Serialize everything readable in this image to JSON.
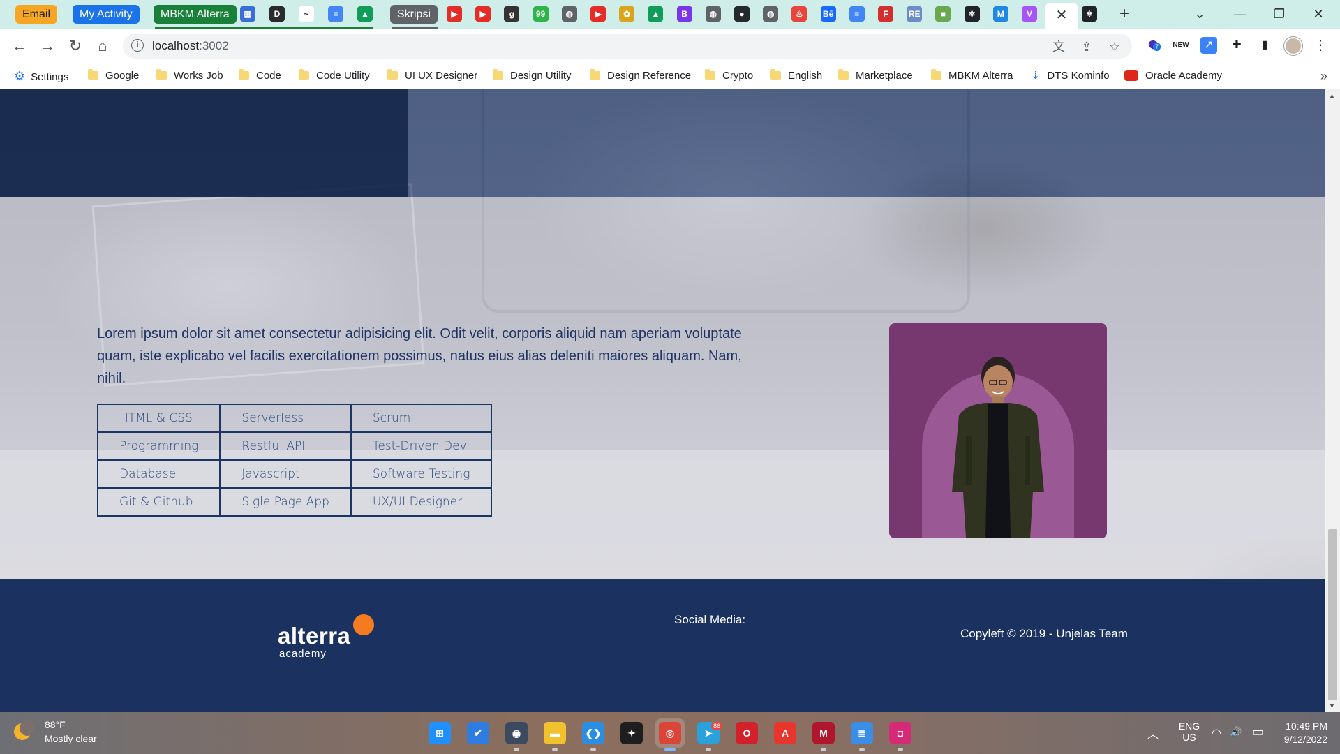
{
  "tabs": {
    "pills": [
      {
        "label": "Email",
        "color": "#f6a623",
        "text_color": "#222"
      },
      {
        "label": "My Activity",
        "color": "#1a73e8",
        "text_color": "#fff"
      },
      {
        "label": "MBKM Alterra",
        "color": "#188038",
        "text_color": "#fff"
      },
      {
        "label": "Skripsi",
        "color": "#5f6368",
        "text_color": "#fff"
      }
    ],
    "favicons": [
      {
        "icon": "calendar-icon",
        "glyph": "▦",
        "color": "#3a6fd8"
      },
      {
        "icon": "d-icon",
        "glyph": "D",
        "color": "#2b2b2b"
      },
      {
        "icon": "chart-icon",
        "glyph": "~",
        "color": "#ffffff"
      },
      {
        "icon": "docs-icon",
        "glyph": "≡",
        "color": "#4285f4"
      },
      {
        "icon": "drive-icon",
        "glyph": "▲",
        "color": "#0f9d58"
      },
      {
        "icon": "youtube-icon",
        "glyph": "▶",
        "color": "#e52d27"
      },
      {
        "icon": "youtube-icon",
        "glyph": "▶",
        "color": "#e52d27"
      },
      {
        "icon": "g-icon",
        "glyph": "g",
        "color": "#333333"
      },
      {
        "icon": "badge-icon",
        "glyph": "99",
        "color": "#2fb44a"
      },
      {
        "icon": "globe-icon",
        "glyph": "◍",
        "color": "#5f6368"
      },
      {
        "icon": "youtube-icon",
        "glyph": "▶",
        "color": "#e52d27"
      },
      {
        "icon": "crest-icon",
        "glyph": "✿",
        "color": "#d8a51d"
      },
      {
        "icon": "drive-icon",
        "glyph": "▲",
        "color": "#0f9d58"
      },
      {
        "icon": "bootstrap-icon",
        "glyph": "B",
        "color": "#7b35e8"
      },
      {
        "icon": "globe-icon",
        "glyph": "◍",
        "color": "#5f6368"
      },
      {
        "icon": "github-icon",
        "glyph": "●",
        "color": "#24292e"
      },
      {
        "icon": "globe-icon",
        "glyph": "◍",
        "color": "#5f6368"
      },
      {
        "icon": "fire-icon",
        "glyph": "♨",
        "color": "#e8453c"
      },
      {
        "icon": "behance-icon",
        "glyph": "Bē",
        "color": "#1769ff"
      },
      {
        "icon": "docs-icon",
        "glyph": "≡",
        "color": "#4285f4"
      },
      {
        "icon": "f-icon",
        "glyph": "F",
        "color": "#d32f2f"
      },
      {
        "icon": "repo-icon",
        "glyph": "RE",
        "color": "#6b8cc7"
      },
      {
        "icon": "square-icon",
        "glyph": "■",
        "color": "#6aa84f"
      },
      {
        "icon": "react-icon",
        "glyph": "⚛",
        "color": "#20232a"
      },
      {
        "icon": "mui-icon",
        "glyph": "M",
        "color": "#1e88e5"
      },
      {
        "icon": "vite-icon",
        "glyph": "V",
        "color": "#a855f7"
      }
    ],
    "active_close": "✕",
    "react_icon": "⚛",
    "new_tab": "+"
  },
  "window": {
    "dropdown": "⌄",
    "minimize": "—",
    "restore": "❐",
    "close": "✕"
  },
  "toolbar": {
    "back": "←",
    "forward": "→",
    "reload": "↻",
    "home": "⌂",
    "url_host": "localhost",
    "url_port": ":3002",
    "translate": "文",
    "share": "⇪",
    "star": "☆",
    "ext_badge": "7",
    "ext_new": "NEW",
    "ext_arrow": "↗",
    "puzzle": "✚",
    "sidepanel": "▮",
    "menu": "⋮"
  },
  "bookmarks": [
    {
      "label": "Settings",
      "type": "gear"
    },
    {
      "label": "Google",
      "type": "folder"
    },
    {
      "label": "Works Job",
      "type": "folder"
    },
    {
      "label": "Code",
      "type": "folder"
    },
    {
      "label": "Code Utility",
      "type": "folder"
    },
    {
      "label": "UI UX Designer",
      "type": "folder"
    },
    {
      "label": "Design Utility",
      "type": "folder"
    },
    {
      "label": "Design Reference",
      "type": "folder"
    },
    {
      "label": "Crypto",
      "type": "folder"
    },
    {
      "label": "English",
      "type": "folder"
    },
    {
      "label": "Marketplace",
      "type": "folder"
    },
    {
      "label": "MBKM Alterra",
      "type": "folder"
    },
    {
      "label": "DTS Kominfo",
      "type": "site"
    },
    {
      "label": "Oracle Academy",
      "type": "oracle"
    }
  ],
  "bookmarks_more": "»",
  "about": {
    "text": "Lorem ipsum dolor sit amet consectetur adipisicing elit. Odit velit, corporis aliquid nam aperiam voluptate quam, iste explicabo vel facilis exercitationem possimus, natus eius alias deleniti maiores aliquam. Nam, nihil.",
    "skills": [
      [
        "HTML & CSS",
        "Serverless",
        "Scrum"
      ],
      [
        "Programming",
        "Restful API",
        "Test-Driven Dev"
      ],
      [
        "Database",
        "Javascript",
        "Software Testing"
      ],
      [
        "Git & Github",
        "Sigle Page App",
        "UX/UI Designer"
      ]
    ]
  },
  "footer": {
    "logo_word": "alterra",
    "logo_sub": "academy",
    "social_label": "Social Media:",
    "copyright": "Copyleft © 2019 - Unjelas Team"
  },
  "taskbar": {
    "temperature": "88°F",
    "condition": "Mostly clear",
    "apps": [
      {
        "icon": "windows-icon",
        "glyph": "⊞",
        "color": "#1e90ff"
      },
      {
        "icon": "todo-icon",
        "glyph": "✔",
        "color": "#2f7de1"
      },
      {
        "icon": "camera-icon",
        "glyph": "◉",
        "color": "#3b4a5e"
      },
      {
        "icon": "file-explorer-icon",
        "glyph": "▬",
        "color": "#f2c12e"
      },
      {
        "icon": "vscode-icon",
        "glyph": "❮❯",
        "color": "#2a8fe3"
      },
      {
        "icon": "figma-icon",
        "glyph": "✦",
        "color": "#1e1e1e"
      },
      {
        "icon": "chrome-icon",
        "glyph": "◎",
        "color": "#db4437"
      },
      {
        "icon": "telegram-icon",
        "glyph": "➤",
        "color": "#2aa1da"
      },
      {
        "icon": "opera-icon",
        "glyph": "O",
        "color": "#d3212b"
      },
      {
        "icon": "acrobat-icon",
        "glyph": "A",
        "color": "#e8362c"
      },
      {
        "icon": "mendeley-icon",
        "glyph": "M",
        "color": "#b0172c"
      },
      {
        "icon": "notepad-icon",
        "glyph": "≣",
        "color": "#3a8ee6"
      },
      {
        "icon": "instagram-icon",
        "glyph": "◘",
        "color": "#d62976"
      }
    ],
    "telegram_badge": "86",
    "tray_chevron": "︿",
    "language": "ENG",
    "region": "US",
    "wifi": "◠",
    "volume": "🔊",
    "battery": "▭",
    "time": "10:49 PM",
    "date": "9/12/2022"
  }
}
